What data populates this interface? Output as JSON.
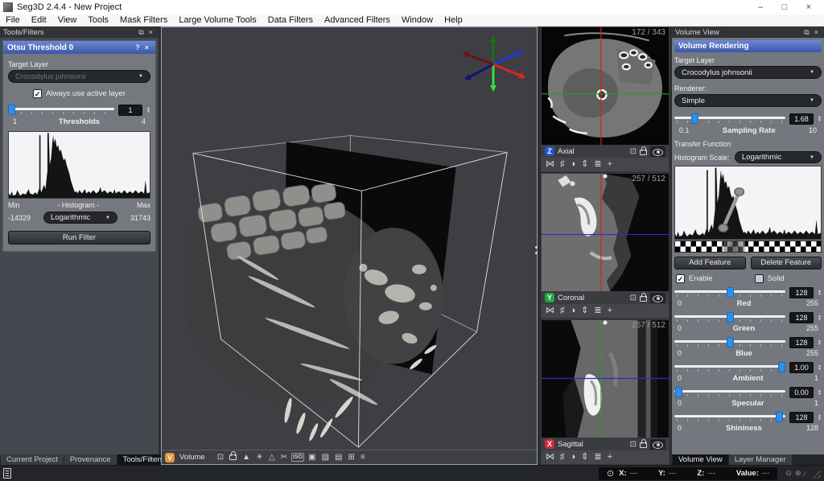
{
  "window": {
    "title": "Seg3D 2.4.4 - New Project",
    "controls": {
      "minimize": "–",
      "maximize": "□",
      "close": "×"
    }
  },
  "menu": {
    "items": [
      "File",
      "Edit",
      "View",
      "Tools",
      "Mask Filters",
      "Large Volume Tools",
      "Data Filters",
      "Advanced Filters",
      "Window",
      "Help"
    ]
  },
  "left_dock": {
    "title": "Tools/Filters",
    "float_icon": "⧉",
    "close_icon": "×",
    "tool": {
      "title": "Otsu Threshold 0",
      "help_icon": "?",
      "close_icon": "×",
      "target_layer_label": "Target Layer",
      "target_layer_value": "Crocodylus johnsonii",
      "always_active_label": "Always use active layer",
      "thresholds": {
        "value": "1",
        "min": "1",
        "label": "Thresholds",
        "max": "4"
      },
      "histogram": {
        "min_label": "Min",
        "center_label": "- Histogram -",
        "max_label": "Max",
        "min_value": "-14329",
        "scale_value": "Logarithmic",
        "max_value": "31743"
      },
      "run_button": "Run Filter"
    },
    "tabs": [
      "Current Project",
      "Provenance",
      "Tools/Filters"
    ],
    "active_tab": "Tools/Filters"
  },
  "viewport": {
    "mode_label": "Volume",
    "badge_letter": "V",
    "toolbar_icons": [
      "⊡",
      "",
      "▲",
      "☀",
      "△",
      "✂",
      "ISO",
      "▣",
      "▨",
      "▤",
      "⊞",
      "≡"
    ]
  },
  "slice_toolbar_icons": [
    "⋈",
    "♯",
    "◑",
    "⇕",
    "≣",
    "+"
  ],
  "slices": [
    {
      "axis": "Z",
      "name": "Axial",
      "counter": "172 / 343",
      "badge_color": "#2a52c8"
    },
    {
      "axis": "Y",
      "name": "Coronal",
      "counter": "257 / 512",
      "badge_color": "#1fa93c"
    },
    {
      "axis": "X",
      "name": "Sagittal",
      "counter": "257 / 512",
      "badge_color": "#d02a3c"
    }
  ],
  "right_dock": {
    "title": "Volume View",
    "float_icon": "⧉",
    "close_icon": "×",
    "header": "Volume Rendering",
    "target_layer_label": "Target Layer",
    "target_layer_value": "Crocodylus johnsonii",
    "renderer_label": "Renderer:",
    "renderer_value": "Simple",
    "sampling": {
      "value": "1.68",
      "min": "0.1",
      "label": "Sampling Rate",
      "max": "10"
    },
    "transfer_function_label": "Transfer Function",
    "histogram_scale_label": "Histogram Scale:",
    "histogram_scale_value": "Logarithmic",
    "add_feature_button": "Add Feature",
    "delete_feature_button": "Delete Feature",
    "enable_label": "Enable",
    "solid_label": "Solid",
    "sliders": [
      {
        "label": "Red",
        "min": "0",
        "max": "255",
        "value": "128"
      },
      {
        "label": "Green",
        "min": "0",
        "max": "255",
        "value": "128"
      },
      {
        "label": "Blue",
        "min": "0",
        "max": "255",
        "value": "128"
      },
      {
        "label": "Ambient",
        "min": "0",
        "max": "1",
        "value": "1.00"
      },
      {
        "label": "Specular",
        "min": "0",
        "max": "1",
        "value": "0.00"
      },
      {
        "label": "Shininess",
        "min": "0",
        "max": "128",
        "value": "128"
      }
    ],
    "tabs": [
      "Volume View",
      "Layer Manager"
    ],
    "active_tab": "Volume View"
  },
  "status_bar": {
    "globe_icon": "⊙",
    "x_label": "X:",
    "x_value": "---",
    "y_label": "Y:",
    "y_value": "---",
    "z_label": "Z:",
    "z_value": "---",
    "value_label": "Value:",
    "value_value": "---",
    "right_icons": [
      "⊙",
      "⊕",
      "∕"
    ]
  },
  "icons": {
    "dropdown_arrow": "▼",
    "spin_up": "▲",
    "spin_down": "▼",
    "check": "✓"
  },
  "colors": {
    "accent_blue": "#2f8fe8",
    "panel_header_gradient_top": "#6c89d4",
    "panel_header_gradient_bottom": "#3a57a8",
    "axis_z_badge": "#2a52c8",
    "axis_y_badge": "#1fa93c",
    "axis_x_badge": "#d02a3c",
    "crosshair_red": "#c8281e",
    "crosshair_green": "#1ea32b",
    "crosshair_blue": "#2330c8",
    "volume_badge_orange": "#e8923a"
  }
}
